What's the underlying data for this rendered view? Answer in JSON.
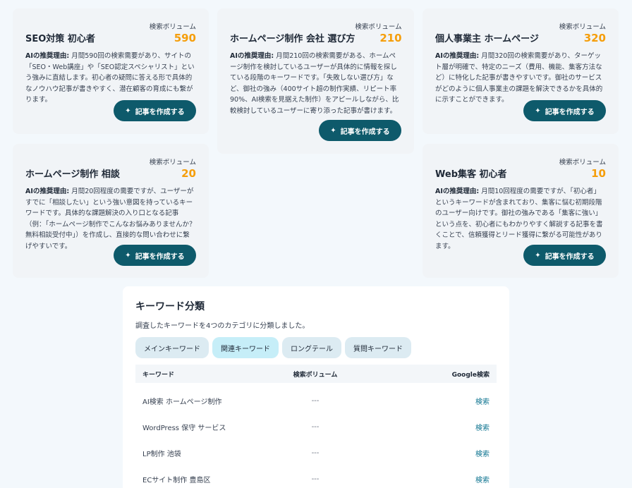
{
  "common": {
    "volume_label": "検索ボリューム",
    "reason_label": "AIの推奨理由:",
    "create_button": "記事を作成する"
  },
  "cards": [
    {
      "title": "SEO対策 初心者",
      "volume": "590",
      "reason": " 月間590回の検索需要があり、サイトの「SEO・Web講座」や「SEO認定スペシャリスト」という強みに直結します。初心者の疑問に答える形で具体的なノウハウ記事が書きやすく、潜在顧客の育成にも繋がります。"
    },
    {
      "title": "ホームページ制作 会社 選び方",
      "volume": "210",
      "reason": " 月間210回の検索需要がある、ホームページ制作を検討しているユーザーが具体的に情報を探している段階のキーワードです。「失敗しない選び方」など、御社の強み（400サイト超の制作実績、リピート率90%、AI検索を見据えた制作）をアピールしながら、比較検討しているユーザーに寄り添った記事が書けます。"
    },
    {
      "title": "個人事業主 ホームページ",
      "volume": "320",
      "reason": " 月間320回の検索需要があり、ターゲット層が明確で、特定のニーズ（費用、機能、集客方法など）に特化した記事が書きやすいです。御社のサービスがどのように個人事業主の課題を解決できるかを具体的に示すことができます。"
    },
    {
      "title": "ホームページ制作 相談",
      "volume": "20",
      "reason": " 月間20回程度の需要ですが、ユーザーがすでに「相談したい」という強い意図を持っているキーワードです。具体的な課題解決の入り口となる記事（例：「ホームページ制作でこんなお悩みありませんか？無料相談受付中」）を作成し、直接的な問い合わせに繋げやすいです。"
    },
    {
      "title": "Web集客 初心者",
      "volume": "10",
      "reason": " 月間10回程度の需要ですが、「初心者」というキーワードが含まれており、集客に悩む初期段階のユーザー向けです。御社の強みである「集客に強い」という点を、初心者にもわかりやすく解説する記事を書くことで、信頼獲得とリード獲得に繋がる可能性があります。"
    }
  ],
  "classification": {
    "title": "キーワード分類",
    "description": "調査したキーワードを4つのカテゴリに分類しました。",
    "tabs": [
      "メインキーワード",
      "関連キーワード",
      "ロングテール",
      "質問キーワード"
    ],
    "active_tab": "関連キーワード",
    "columns": [
      "キーワード",
      "検索ボリューム",
      "Google検索"
    ],
    "rows": [
      {
        "keyword": "AI検索 ホームページ制作",
        "volume": "---",
        "search": "検索"
      },
      {
        "keyword": "WordPress 保守 サービス",
        "volume": "---",
        "search": "検索"
      },
      {
        "keyword": "LP制作 池袋",
        "volume": "---",
        "search": "検索"
      },
      {
        "keyword": "ECサイト制作 豊島区",
        "volume": "---",
        "search": "検索"
      }
    ]
  },
  "colors": {
    "accent_button": "#0e5a6b",
    "volume_value": "#f59e0b",
    "active_tab": "#c6eef8",
    "link": "#0e7490"
  }
}
